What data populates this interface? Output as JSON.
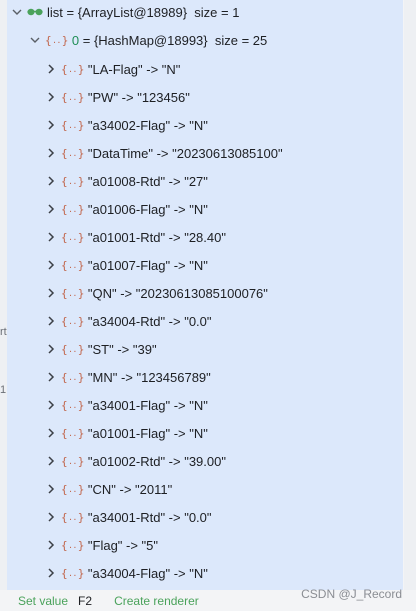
{
  "root": {
    "name": "list",
    "value": "{ArrayList@18989}",
    "size_text": "size = 1"
  },
  "child": {
    "index": "0",
    "value": "= {HashMap@18993}",
    "size_text": "size = 25"
  },
  "entries": [
    "\"LA-Flag\" -> \"N\"",
    "\"PW\" -> \"123456\"",
    "\"a34002-Flag\" -> \"N\"",
    "\"DataTime\" -> \"20230613085100\"",
    "\"a01008-Rtd\" -> \"27\"",
    "\"a01006-Flag\" -> \"N\"",
    "\"a01001-Rtd\" -> \"28.40\"",
    "\"a01007-Flag\" -> \"N\"",
    "\"QN\" -> \"20230613085100076\"",
    "\"a34004-Rtd\" -> \"0.0\"",
    "\"ST\" -> \"39\"",
    "\"MN\" -> \"123456789\"",
    "\"a34001-Flag\" -> \"N\"",
    "\"a01001-Flag\" -> \"N\"",
    "\"a01002-Rtd\" -> \"39.00\"",
    "\"CN\" -> \"2011\"",
    "\"a34001-Rtd\" -> \"0.0\"",
    "\"Flag\" -> \"5\"",
    "\"a34004-Flag\" -> \"N\""
  ],
  "statusbar": {
    "set_value": "Set value",
    "set_value_key": "F2",
    "create_renderer": "Create renderer"
  },
  "watermark": "CSDN @J_Record",
  "edge_fragments": [
    "rt",
    "1"
  ],
  "colors": {
    "tree_background": "#dce8fb",
    "index_green": "#1f8e56",
    "object_icon": "#c1654b",
    "link_green": "#4aa25b"
  },
  "icons": {
    "root": "glasses-icon",
    "object": "object-braces-icon",
    "expanded": "chevron-down-icon",
    "collapsed": "chevron-right-icon"
  }
}
